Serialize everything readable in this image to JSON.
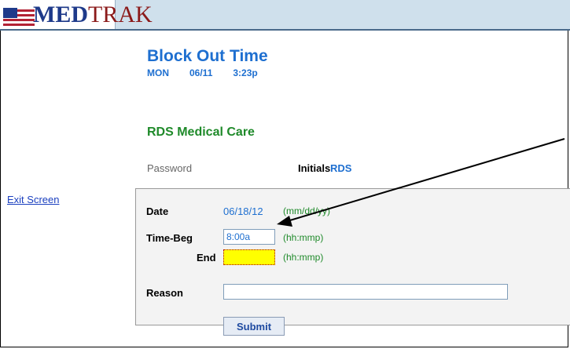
{
  "app": {
    "logo_text_bold": "MED",
    "logo_text_rest": "TRAK"
  },
  "page": {
    "title": "Block Out Time",
    "day": "MON",
    "date": "06/11",
    "time": "3:23p",
    "practice_name": "RDS Medical Care"
  },
  "auth": {
    "password_label": "Password",
    "initials_label": "Initials",
    "initials_value": "RDS"
  },
  "nav": {
    "exit_label": "Exit Screen"
  },
  "form": {
    "date_label": "Date",
    "date_value": "06/18/12",
    "date_hint": "(mm/dd/yy)",
    "time_beg_label": "Time-Beg",
    "time_beg_value": "8:00a",
    "time_hint": "(hh:mmp)",
    "end_label": "End",
    "end_value": "",
    "end_hint": "(hh:mmp)",
    "reason_label": "Reason",
    "reason_value": "",
    "submit_label": "Submit"
  },
  "colors": {
    "accent_blue": "#1e6fd0",
    "green": "#1f8a2a",
    "active_field": "#ffff00"
  }
}
